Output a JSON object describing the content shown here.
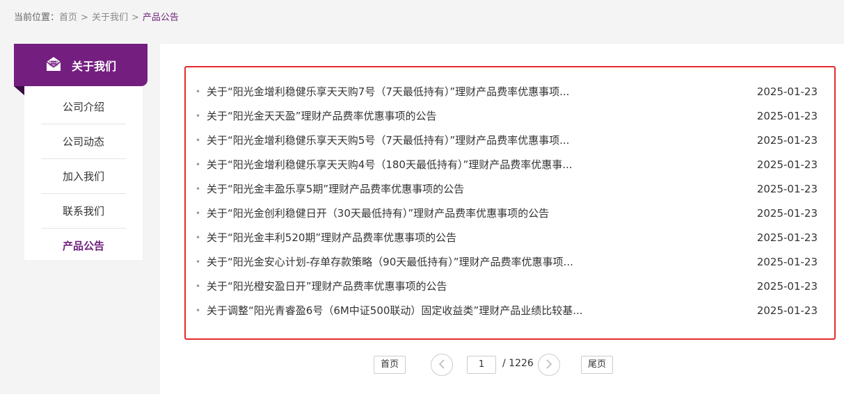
{
  "breadcrumb": {
    "prefix": "当前位置：",
    "items": [
      "首页",
      "关于我们",
      "产品公告"
    ],
    "separator": ">"
  },
  "sidebar": {
    "header_label": "关于我们",
    "header_icon": "envelope-icon",
    "items": [
      {
        "label": "公司介绍",
        "active": false
      },
      {
        "label": "公司动态",
        "active": false
      },
      {
        "label": "加入我们",
        "active": false
      },
      {
        "label": "联系我们",
        "active": false
      },
      {
        "label": "产品公告",
        "active": true
      }
    ]
  },
  "announcements": [
    {
      "title": "关于“阳光金增利稳健乐享天天购7号（7天最低持有）”理财产品费率优惠事项...",
      "date": "2025-01-23"
    },
    {
      "title": "关于“阳光金天天盈”理财产品费率优惠事项的公告",
      "date": "2025-01-23"
    },
    {
      "title": "关于“阳光金增利稳健乐享天天购5号（7天最低持有）”理财产品费率优惠事项...",
      "date": "2025-01-23"
    },
    {
      "title": "关于“阳光金增利稳健乐享天天购4号（180天最低持有）”理财产品费率优惠事...",
      "date": "2025-01-23"
    },
    {
      "title": "关于“阳光金丰盈乐享5期”理财产品费率优惠事项的公告",
      "date": "2025-01-23"
    },
    {
      "title": "关于“阳光金创利稳健日开（30天最低持有）”理财产品费率优惠事项的公告",
      "date": "2025-01-23"
    },
    {
      "title": "关于“阳光金丰利520期”理财产品费率优惠事项的公告",
      "date": "2025-01-23"
    },
    {
      "title": "关于“阳光金安心计划-存单存款策略（90天最低持有）”理财产品费率优惠事项...",
      "date": "2025-01-23"
    },
    {
      "title": "关于“阳光橙安盈日开”理财产品费率优惠事项的公告",
      "date": "2025-01-23"
    },
    {
      "title": "关于调整“阳光青睿盈6号（6M中证500联动）固定收益类”理财产品业绩比较基...",
      "date": "2025-01-23"
    }
  ],
  "pagination": {
    "first_label": "首页",
    "last_label": "尾页",
    "current_page": "1",
    "total_text": "/ 1226",
    "prev_icon": "chevron-left-icon",
    "next_icon": "chevron-right-icon"
  },
  "colors": {
    "brand": "#741f80",
    "highlight_border": "#e62a2a"
  }
}
